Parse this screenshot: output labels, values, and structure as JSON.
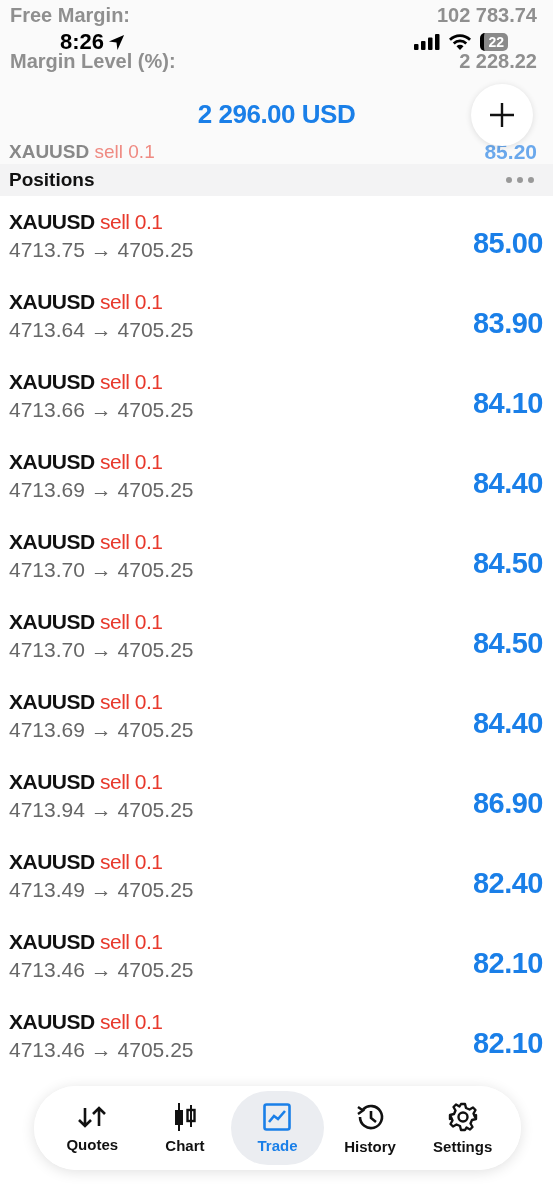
{
  "status_bar": {
    "time": "8:26",
    "battery": "22"
  },
  "account": [
    {
      "label": "Free Margin:",
      "value": "102 783.74"
    },
    {
      "label": "Margin Level (%):",
      "value": "2 228.22"
    }
  ],
  "balance": "2 296.00 USD",
  "faded_position": {
    "symbol": "XAUUSD",
    "side": "sell 0.1",
    "profit": "85.20"
  },
  "section_title": "Positions",
  "positions": [
    {
      "symbol": "XAUUSD",
      "side": "sell 0.1",
      "prices": "4713.75 → 4705.25",
      "profit": "85.00"
    },
    {
      "symbol": "XAUUSD",
      "side": "sell 0.1",
      "prices": "4713.64 → 4705.25",
      "profit": "83.90"
    },
    {
      "symbol": "XAUUSD",
      "side": "sell 0.1",
      "prices": "4713.66 → 4705.25",
      "profit": "84.10"
    },
    {
      "symbol": "XAUUSD",
      "side": "sell 0.1",
      "prices": "4713.69 → 4705.25",
      "profit": "84.40"
    },
    {
      "symbol": "XAUUSD",
      "side": "sell 0.1",
      "prices": "4713.70 → 4705.25",
      "profit": "84.50"
    },
    {
      "symbol": "XAUUSD",
      "side": "sell 0.1",
      "prices": "4713.70 → 4705.25",
      "profit": "84.50"
    },
    {
      "symbol": "XAUUSD",
      "side": "sell 0.1",
      "prices": "4713.69 → 4705.25",
      "profit": "84.40"
    },
    {
      "symbol": "XAUUSD",
      "side": "sell 0.1",
      "prices": "4713.94 → 4705.25",
      "profit": "86.90"
    },
    {
      "symbol": "XAUUSD",
      "side": "sell 0.1",
      "prices": "4713.49 → 4705.25",
      "profit": "82.40"
    },
    {
      "symbol": "XAUUSD",
      "side": "sell 0.1",
      "prices": "4713.46 → 4705.25",
      "profit": "82.10"
    },
    {
      "symbol": "XAUUSD",
      "side": "sell 0.1",
      "prices": "4713.46 → 4705.25",
      "profit": "82.10"
    }
  ],
  "tabs": [
    {
      "label": "Quotes",
      "kind": "quotes",
      "selected": false
    },
    {
      "label": "Chart",
      "kind": "chart",
      "selected": false
    },
    {
      "label": "Trade",
      "kind": "trade",
      "selected": true
    },
    {
      "label": "History",
      "kind": "history",
      "selected": false
    },
    {
      "label": "Settings",
      "kind": "settings",
      "selected": false
    }
  ]
}
